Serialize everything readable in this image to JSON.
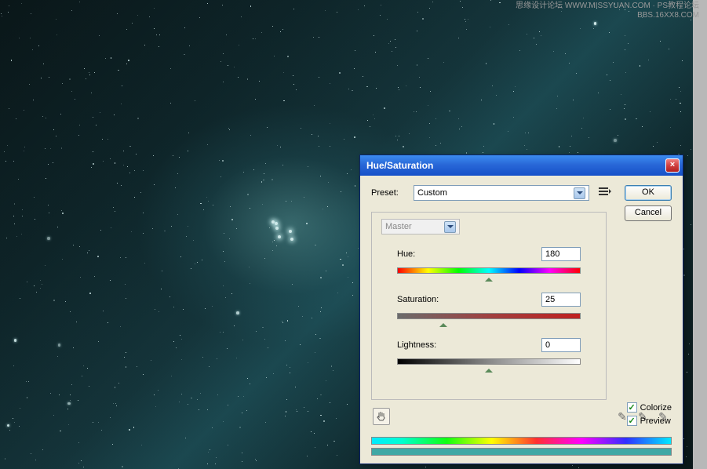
{
  "watermark": {
    "line1": "思缘设计论坛 WWW.MISSYUAN.COM · PS教程论坛",
    "line2": "BBS.16XX8.COM"
  },
  "dialog": {
    "title": "Hue/Saturation",
    "close": "×",
    "preset_label": "Preset:",
    "preset_value": "Custom",
    "ok": "OK",
    "cancel": "Cancel",
    "edit_value": "Master",
    "hue_label": "Hue:",
    "hue_value": "180",
    "sat_label": "Saturation:",
    "sat_value": "25",
    "lig_label": "Lightness:",
    "lig_value": "0",
    "colorize_label": "Colorize",
    "preview_label": "Preview"
  }
}
